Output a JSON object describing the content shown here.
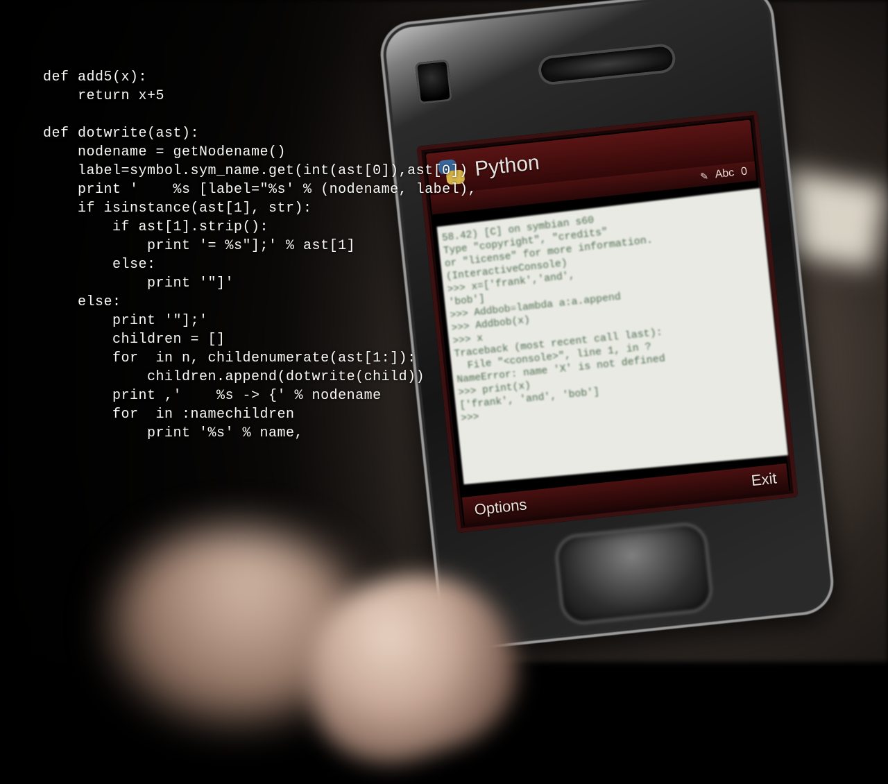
{
  "overlay_code": "def add5(x):\n    return x+5\n\ndef dotwrite(ast):\n    nodename = getNodename()\n    label=symbol.sym_name.get(int(ast[0]),ast[0])\n    print '    %s [label=\"%s' % (nodename, label),\n    if isinstance(ast[1], str):\n        if ast[1].strip():\n            print '= %s\"];' % ast[1]\n        else:\n            print '\"]'\n    else:\n        print '\"];'\n        children = []\n        for  in n, childenumerate(ast[1:]):\n            children.append(dotwrite(child))\n        print ,'    %s -> {' % nodename\n        for  in :namechildren\n            print '%s' % name,",
  "phone": {
    "app_title": "Python",
    "status": {
      "mode": "Abc",
      "count": "0"
    },
    "console_text": "58.42) [C] on symbian s60\nType \"copyright\", \"credits\"\nor \"license\" for more information.\n(InteractiveConsole)\n>>> x=['frank','and',\n'bob']\n>>> Addbob=lambda a:a.append\n>>> Addbob(x)\n>>> x\nTraceback (most recent call last):\n  File \"<console>\", line 1, in ?\nNameError: name 'X' is not defined\n>>> print(x)\n['frank', 'and', 'bob']\n>>> ",
    "softkeys": {
      "left": "Options",
      "right": "Exit"
    }
  }
}
